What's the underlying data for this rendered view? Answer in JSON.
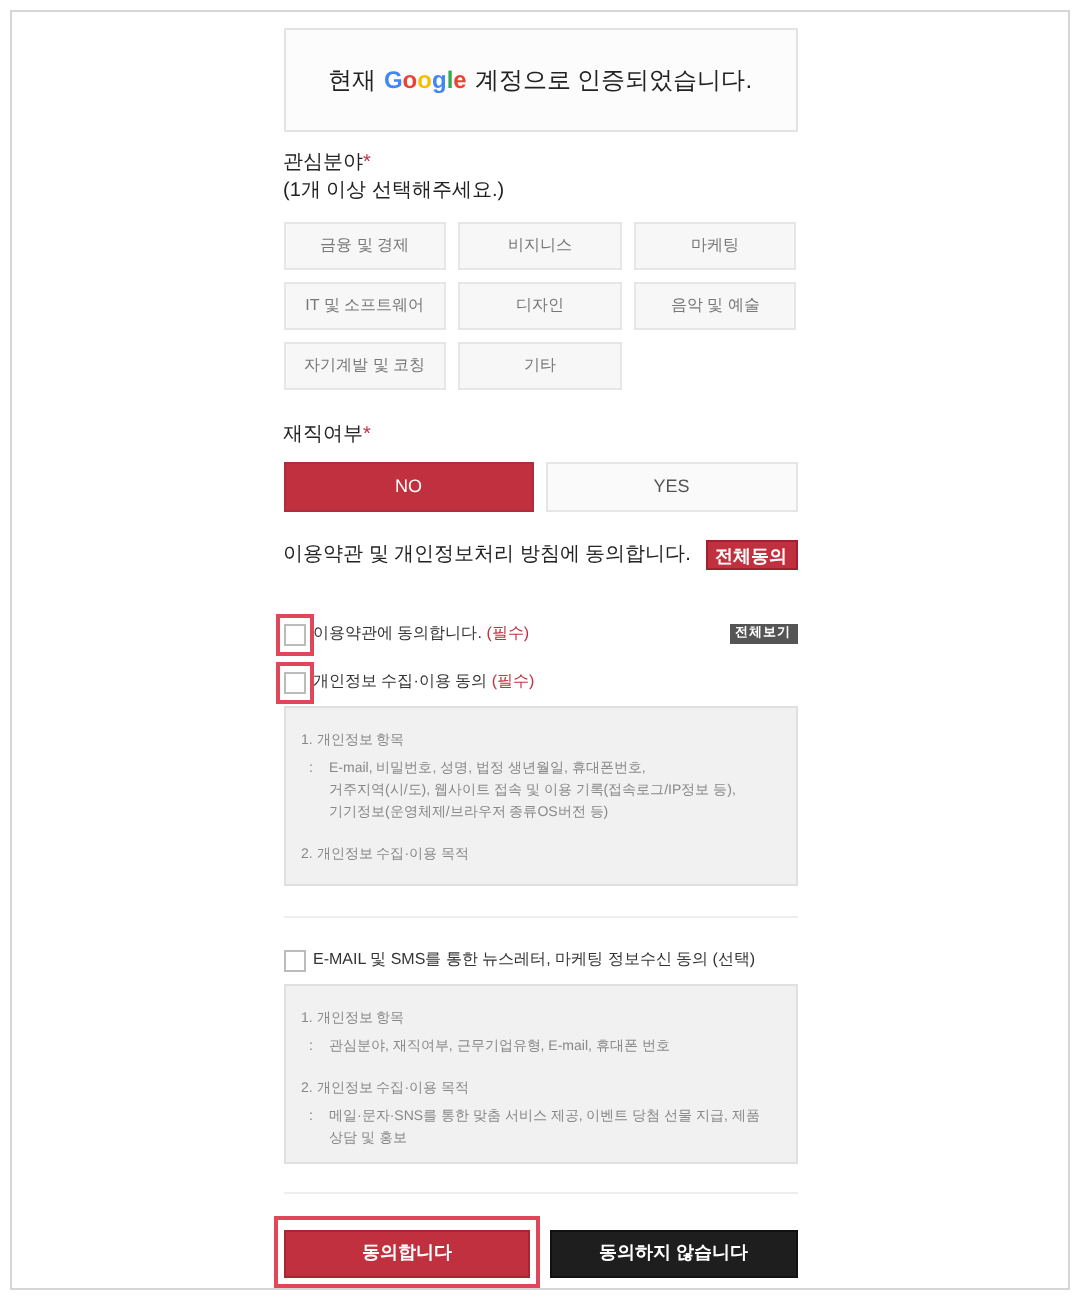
{
  "auth_notice": {
    "prefix": "현재",
    "brand": "Google",
    "suffix": "계정으로 인증되었습니다."
  },
  "interests": {
    "label": "관심분야",
    "required_mark": "*",
    "hint": "(1개 이상 선택해주세요.)",
    "options": [
      {
        "label": "금융 및 경제",
        "selected": false
      },
      {
        "label": "비지니스",
        "selected": false
      },
      {
        "label": "마케팅",
        "selected": false
      },
      {
        "label": "IT 및 소프트웨어",
        "selected": false
      },
      {
        "label": "디자인",
        "selected": false
      },
      {
        "label": "음악 및 예술",
        "selected": false
      },
      {
        "label": "자기계발 및 코칭",
        "selected": false
      },
      {
        "label": "기타",
        "selected": false
      }
    ]
  },
  "employment": {
    "label": "재직여부",
    "required_mark": "*",
    "options": [
      {
        "label": "NO",
        "selected": true
      },
      {
        "label": "YES",
        "selected": false
      }
    ]
  },
  "terms": {
    "heading": "이용약관 및 개인정보처리 방침에 동의합니다.",
    "agree_all": "전체동의",
    "items": [
      {
        "label": "이용약관에 동의합니다.",
        "tag": "(필수)",
        "checked": false,
        "highlighted": true,
        "view_all": "전체보기"
      },
      {
        "label": "개인정보 수집·이용 동의",
        "tag": "(필수)",
        "checked": false,
        "highlighted": true,
        "details": [
          {
            "title": "1. 개인정보 항목",
            "sep": ":",
            "lines": [
              "E-mail, 비밀번호, 성명, 법정 생년월일, 휴대폰번호,",
              "거주지역(시/도), 웹사이트 접속 및 이용 기록(접속로그/IP정보 등),",
              "기기정보(운영체제/브라우저 종류OS버전 등)"
            ]
          },
          {
            "title": "2. 개인정보 수집·이용 목적"
          }
        ]
      },
      {
        "label": "E-MAIL 및 SMS를 통한 뉴스레터, 마케팅 정보수신 동의 (선택)",
        "checked": false,
        "highlighted": false,
        "details": [
          {
            "title": "1. 개인정보 항목",
            "sep": ":",
            "lines": [
              "관심분야, 재직여부, 근무기업유형, E-mail, 휴대폰 번호"
            ]
          },
          {
            "title": "2. 개인정보 수집·이용 목적",
            "sep": ":",
            "lines": [
              "메일·문자·SNS를 통한 맞춤 서비스 제공, 이벤트 당첨 선물 지급, 제품",
              "상담 및 홍보"
            ]
          }
        ]
      }
    ]
  },
  "actions": [
    {
      "label": "동의합니다",
      "kind": "primary",
      "highlighted": true
    },
    {
      "label": "동의하지 않습니다",
      "kind": "dark",
      "highlighted": false
    }
  ]
}
